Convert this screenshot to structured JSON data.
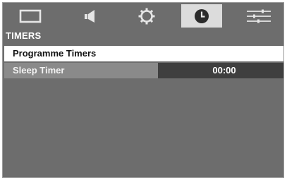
{
  "tabs": [
    {
      "icon": "picture-icon",
      "active": false
    },
    {
      "icon": "sound-icon",
      "active": false
    },
    {
      "icon": "settings-icon",
      "active": false
    },
    {
      "icon": "clock-icon",
      "active": true
    },
    {
      "icon": "options-icon",
      "active": false
    }
  ],
  "section": {
    "title": "TIMERS"
  },
  "menu": {
    "items": [
      {
        "label": "Programme Timers",
        "value": "",
        "selected": true
      },
      {
        "label": "Sleep Timer",
        "value": "00:00",
        "selected": false
      }
    ]
  },
  "colors": {
    "background": "#6d6d6d",
    "active_tab": "#dcdcdc",
    "selected_row": "#ffffff",
    "row": "#8a8a8a",
    "value_box": "#3f3f3f"
  }
}
